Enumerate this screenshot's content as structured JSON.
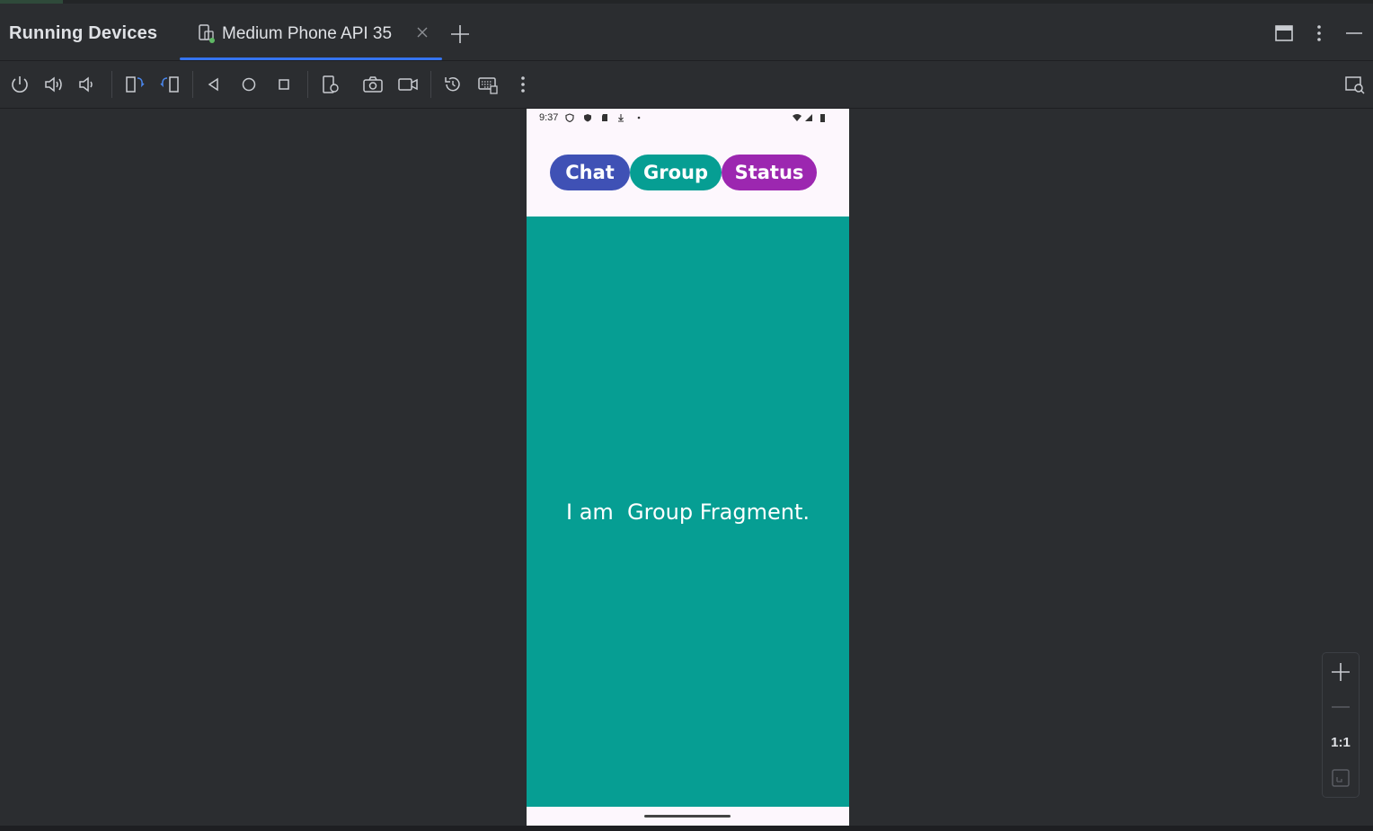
{
  "panel": {
    "title": "Running Devices",
    "tab_label": "Medium Phone API 35"
  },
  "icons": {
    "tab": "phone-running-icon",
    "close": "close-icon",
    "add": "plus-icon",
    "layout": "window-layout-icon",
    "more": "kebab-menu-icon",
    "minimize": "minimize-icon"
  },
  "toolbar": {
    "buttons": [
      "power-icon",
      "volume-up-icon",
      "volume-down-icon",
      "rotate-left-icon",
      "rotate-right-icon",
      "back-icon",
      "home-icon",
      "overview-icon",
      "device-settings-icon",
      "screenshot-icon",
      "screen-record-icon",
      "reset-icon",
      "keyboard-icon",
      "more-icon",
      "layout-inspector-icon"
    ]
  },
  "device": {
    "status_time": "9:37",
    "buttons": [
      {
        "label": "Chat",
        "color": "#3f51b5"
      },
      {
        "label": "Group",
        "color": "#069e93"
      },
      {
        "label": "Status",
        "color": "#9c27b0"
      }
    ],
    "content_text": "I am  Group Fragment.",
    "content_bg": "#069e93"
  },
  "zoom": {
    "zoom_in": "plus-icon",
    "zoom_out": "minus-icon",
    "actual_size": "1:1",
    "fit": "fit-screen-icon"
  },
  "colors": {
    "accent": "#3574f0",
    "background": "#2b2d30"
  }
}
